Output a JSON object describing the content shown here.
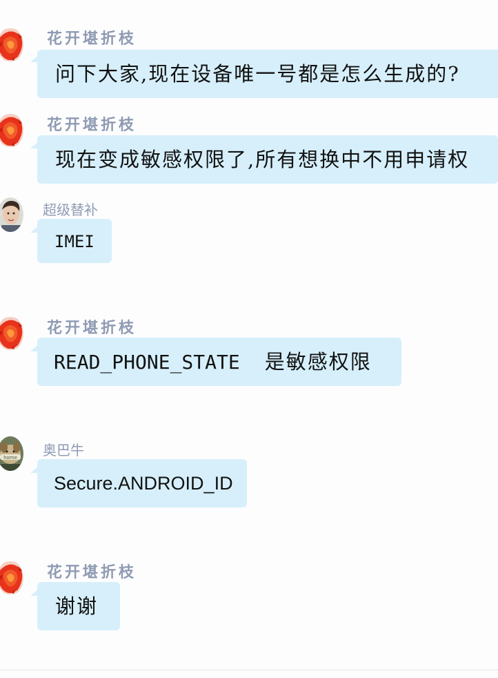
{
  "messages": [
    {
      "sender": "花开堪折枝",
      "text": "问下大家,现在设备唯一号都是怎么生成的?",
      "avatar": "red-flower-avatar"
    },
    {
      "sender": "花开堪折枝",
      "text": "现在变成敏感权限了,所有想换中不用申请权",
      "avatar": "red-flower-avatar"
    },
    {
      "sender": "超级替补",
      "text": "IMEI",
      "avatar": "person-photo-avatar"
    },
    {
      "sender": "花开堪折枝",
      "text_code": "READ_PHONE_STATE",
      "text_rest": "是敏感权限",
      "avatar": "red-flower-avatar"
    },
    {
      "sender": "奥巴牛",
      "text": "Secure.ANDROID_ID",
      "avatar": "dog-photo-avatar"
    },
    {
      "sender": "花开堪折枝",
      "text": "谢谢",
      "avatar": "red-flower-avatar"
    }
  ],
  "colors": {
    "bubble": "#d6effb",
    "sender_name": "#8f9bb3",
    "background": "#fdfdfe",
    "avatar_red": "#e8331c"
  }
}
